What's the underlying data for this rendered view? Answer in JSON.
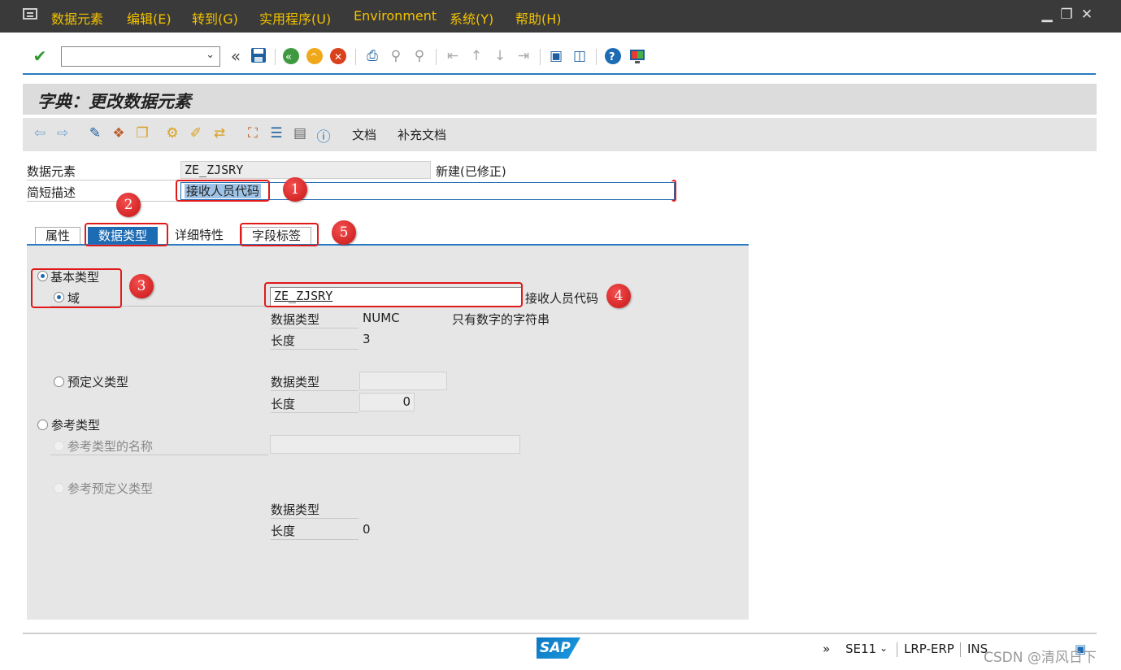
{
  "menu": {
    "items": [
      "数据元素",
      "编辑(E)",
      "转到(G)",
      "实用程序(U)",
      "Environment",
      "系统(Y)",
      "帮助(H)"
    ]
  },
  "window_controls": {
    "minimize": "▁",
    "maximize": "❐",
    "close": "✕"
  },
  "toolbar": {
    "command_field_value": "",
    "back_chevron": "«"
  },
  "title": "字典：更改数据元素",
  "app_toolbar": {
    "doc_label": "文档",
    "supp_doc_label": "补充文档"
  },
  "header": {
    "data_element_label": "数据元素",
    "data_element_value": "ZE_ZJSRY",
    "status_text": "新建(已修正)",
    "short_desc_label": "简短描述",
    "short_desc_value": "接收人员代码"
  },
  "tabs": [
    {
      "label": "属性",
      "active": false
    },
    {
      "label": "数据类型",
      "active": true
    },
    {
      "label": "详细特性",
      "active": false
    },
    {
      "label": "字段标签",
      "active": false
    }
  ],
  "data_type_tab": {
    "elementary_label": "基本类型",
    "domain_label": "域",
    "domain_value": "ZE_ZJSRY",
    "domain_desc": "接收人员代码",
    "dtype_label": "数据类型",
    "dtype_value": "NUMC",
    "dtype_desc": "只有数字的字符串",
    "length_label": "长度",
    "length_value": "3",
    "predefined_label": "预定义类型",
    "pre_dtype_label": "数据类型",
    "pre_dtype_value": "",
    "pre_length_label": "长度",
    "pre_length_value": "0",
    "reference_label": "参考类型",
    "ref_name_label": "参考类型的名称",
    "ref_name_value": "",
    "ref_predef_label": "参考预定义类型",
    "ref_dtype_label": "数据类型",
    "ref_length_label": "长度",
    "ref_length_value": "0"
  },
  "annotations": [
    "1",
    "2",
    "3",
    "4",
    "5"
  ],
  "statusbar": {
    "sap_logo": "SAP",
    "more": "»",
    "transaction": "SE11",
    "system": "LRP-ERP",
    "mode": "INS",
    "watermark": "CSDN @清风日下"
  },
  "colors": {
    "menu_bg": "#3a3a3a",
    "menu_text": "#f2c200",
    "accent": "#1d6bb3",
    "annotation": "#e01919"
  }
}
